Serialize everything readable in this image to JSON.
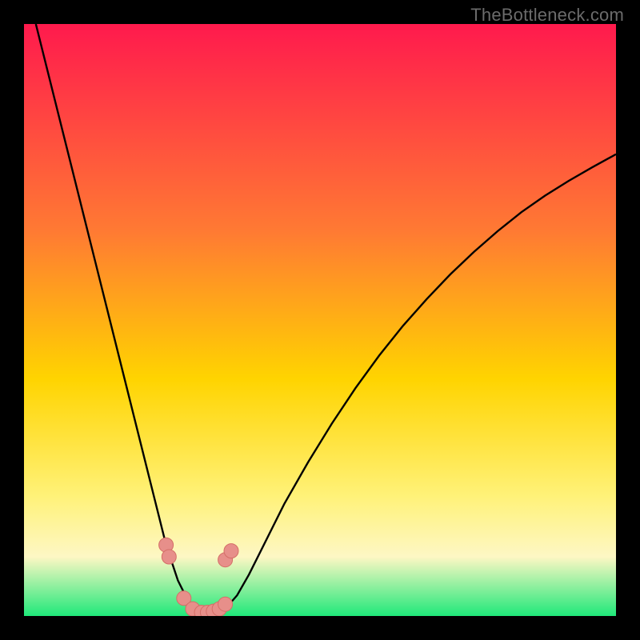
{
  "watermark": "TheBottleneck.com",
  "colors": {
    "black": "#000000",
    "curve": "#000000",
    "marker_fill": "#e78f8a",
    "marker_stroke": "#d46e67",
    "grad_top": "#ff1a4d",
    "grad_mid_upper": "#ff7a33",
    "grad_mid": "#ffd400",
    "grad_lower_yellow": "#fff27a",
    "grad_cream": "#fdf7c4",
    "grad_green": "#1fe87a"
  },
  "chart_data": {
    "type": "line",
    "title": "",
    "xlabel": "",
    "ylabel": "",
    "xlim": [
      0,
      100
    ],
    "ylim": [
      0,
      100
    ],
    "grid": false,
    "curve": {
      "name": "bottleneck-curve",
      "x": [
        2,
        4,
        6,
        8,
        10,
        12,
        14,
        16,
        18,
        20,
        22,
        24,
        25,
        26,
        27,
        28,
        29,
        30,
        31,
        32,
        33,
        34,
        36,
        38,
        40,
        42,
        44,
        48,
        52,
        56,
        60,
        64,
        68,
        72,
        76,
        80,
        84,
        88,
        92,
        96,
        100
      ],
      "y": [
        100,
        92,
        84,
        76,
        68,
        60,
        52,
        44,
        36,
        28,
        20,
        12,
        9,
        6,
        4,
        2.2,
        1.2,
        0.6,
        0.4,
        0.4,
        0.6,
        1.2,
        3.5,
        7,
        11,
        15,
        19,
        26,
        32.5,
        38.5,
        44,
        49,
        53.5,
        57.7,
        61.5,
        65,
        68.2,
        71,
        73.5,
        75.8,
        78
      ]
    },
    "low_band": {
      "y_start": 12,
      "y_end": 0
    },
    "markers": {
      "name": "highlighted-points",
      "points": [
        {
          "x": 24.0,
          "y": 12.0
        },
        {
          "x": 24.5,
          "y": 10.0
        },
        {
          "x": 27.0,
          "y": 3.0
        },
        {
          "x": 28.5,
          "y": 1.2
        },
        {
          "x": 30.0,
          "y": 0.6
        },
        {
          "x": 31.0,
          "y": 0.6
        },
        {
          "x": 32.0,
          "y": 0.8
        },
        {
          "x": 33.0,
          "y": 1.2
        },
        {
          "x": 34.0,
          "y": 2.0
        },
        {
          "x": 34.0,
          "y": 9.5
        },
        {
          "x": 35.0,
          "y": 11.0
        }
      ],
      "radius": 9
    }
  }
}
